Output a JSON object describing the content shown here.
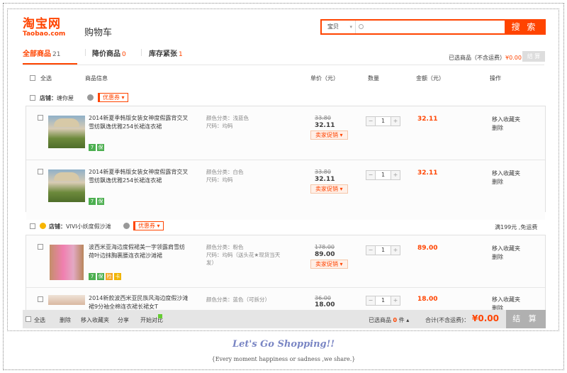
{
  "header": {
    "logo_cn": "淘宝网",
    "logo_en": "Taobao.com",
    "cart_title": "购物车",
    "search_category": "宝贝",
    "search_placeholder": "",
    "search_button": "搜 索",
    "brand_color": "#ff4400"
  },
  "tabs": [
    {
      "label": "全部商品",
      "count": "21",
      "active": true
    },
    {
      "label": "降价商品",
      "count": "0",
      "active": false
    },
    {
      "label": "库存紧张",
      "count": "1",
      "active": false
    }
  ],
  "summary": {
    "label": "已选商品（不含运费）",
    "amount": "¥0.00",
    "settle_label": "结 算"
  },
  "columns": {
    "select_all": "全选",
    "info": "商品信息",
    "price": "单价（元）",
    "qty": "数量",
    "amount": "金额（元）",
    "op": "操作"
  },
  "shops": [
    {
      "label": "店铺：",
      "name": "缠你屋",
      "coupon": "优惠券",
      "free_ship": "",
      "items": [
        {
          "title": "2014新夏季韩版女装女神度假露背交叉雪纺飘逸优雅254长裙连衣裙",
          "sku_color": "颜色分类：浅蓝色",
          "sku_size": "尺码：均码",
          "price_old": "33.80",
          "price_new": "32.11",
          "promo": "卖家促销",
          "qty": "1",
          "total": "32.11",
          "op_fav": "移入收藏夹",
          "op_del": "删除"
        },
        {
          "title": "2014新夏季韩版女装女神度假露背交叉雪纺飘逸优雅254长裙连衣裙",
          "sku_color": "颜色分类：白色",
          "sku_size": "尺码：均码",
          "price_old": "33.80",
          "price_new": "32.11",
          "promo": "卖家促销",
          "qty": "1",
          "total": "32.11",
          "op_fav": "移入收藏夹",
          "op_del": "删除"
        }
      ]
    },
    {
      "label": "店铺：",
      "name": "VIVI小妖度假沙滩",
      "coupon": "优惠券",
      "free_ship": "满199元 ,免运费",
      "items": [
        {
          "title": "波西米亚海边度假裙美一字领露肩雪纺荷叶边抹胸裹腰连衣裙沙滩裙",
          "sku_color": "颜色分类：粉色",
          "sku_size": "尺码：均码（送头花★现货当天",
          "sku_extra": "发）",
          "price_old": "178.00",
          "price_new": "89.00",
          "promo": "卖家促销",
          "qty": "1",
          "total": "89.00",
          "op_fav": "移入收藏夹",
          "op_del": "删除"
        },
        {
          "title": "2014新款波西米亚民族风海边度假沙滩裙9分袖全棉连衣裙长裙女T",
          "sku_color": "颜色分类：蓝色（可拆分）",
          "sku_size": "",
          "price_old": "36.00",
          "price_new": "18.00",
          "promo": "",
          "qty": "1",
          "total": "18.00",
          "op_fav": "移入收藏夹",
          "op_del": "删除"
        }
      ]
    }
  ],
  "badges": [
    "7",
    "保",
    "险",
    "卡"
  ],
  "footer": {
    "select_all": "全选",
    "delete": "删除",
    "move_fav": "移入收藏夹",
    "share": "分享",
    "compare": "开始对比",
    "selected_label": "已选商品",
    "selected_count": "0",
    "selected_unit": "件",
    "total_label": "合计(不含运费)：",
    "total": "¥0.00",
    "settle": "结 算"
  },
  "caption": {
    "slogan": "Let's Go Shopping!!",
    "text": "{Every moment happiness or sadness ,we share.}"
  }
}
